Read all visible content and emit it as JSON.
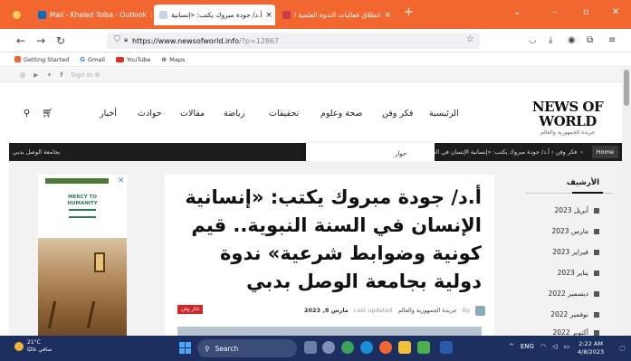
{
  "browser": {
    "tabs": [
      {
        "title": "Mail - Khaled Tolba - Outlook",
        "close": "×"
      },
      {
        "title": "أ.د/ جودة مبروك يكتب: «إنسانية",
        "close": "×"
      },
      {
        "title": "انطلاق فعاليات الندوة العلمية ا",
        "close": "×"
      }
    ],
    "new_tab": "+",
    "url_host": "https://www.newsofworld.info",
    "url_rest": "/?p=12867",
    "bookmarks": [
      {
        "label": "Getting Started"
      },
      {
        "label": "Gmail"
      },
      {
        "label": "YouTube"
      },
      {
        "label": "Maps"
      }
    ],
    "colors": {
      "accent": "#f2672f"
    }
  },
  "topbar": {
    "signin": "Sign In"
  },
  "site": {
    "logo": "NEWS OF WORLD",
    "logo_tagline": "جريدة الجمهورية والعالم",
    "menu": [
      "الرئيسية",
      "فكر وفن",
      "صحة وعلوم",
      "تحقيقات",
      "رياضة",
      "مقالات",
      "حوادث",
      "أخبار"
    ],
    "dropdown_item": "حوار"
  },
  "breadcrumb": {
    "home": "Home",
    "sep": "›",
    "trail": "فكر وفن  ›  أ.د/ جودة مبروك يكتب: «إنسانية الإنسان في السنة النبوية",
    "ticker": "بجامعة الوصل بدبي"
  },
  "article": {
    "headline": "أ.د/ جودة مبروك يكتب: «إنسانية الإنسان في السنة النبوية.. قيم كونية وضوابط شرعية» ندوة دولية بجامعة الوصل بدبي",
    "author_prefix": "By",
    "author": "جريدة الجمهورية والعالم",
    "updated": "Last updated",
    "date": "مارس 8, 2023",
    "category": "فكر وفن"
  },
  "ad": {
    "line1": "MERCY TO",
    "line2": "HUMANITY",
    "close": "✕"
  },
  "archive": {
    "title": "الأرشيف",
    "items": [
      "أبريل 2023",
      "مارس 2023",
      "فبراير 2023",
      "يناير 2023",
      "ديسمبر 2022",
      "نوفمبر 2022",
      "أكتوبر 2022"
    ]
  },
  "taskbar": {
    "weather_temp": "21°C",
    "weather_desc": "صافي غالبًا",
    "search": "Search",
    "lang": "ENG",
    "time": "2:22 AM",
    "date": "4/8/2023"
  }
}
